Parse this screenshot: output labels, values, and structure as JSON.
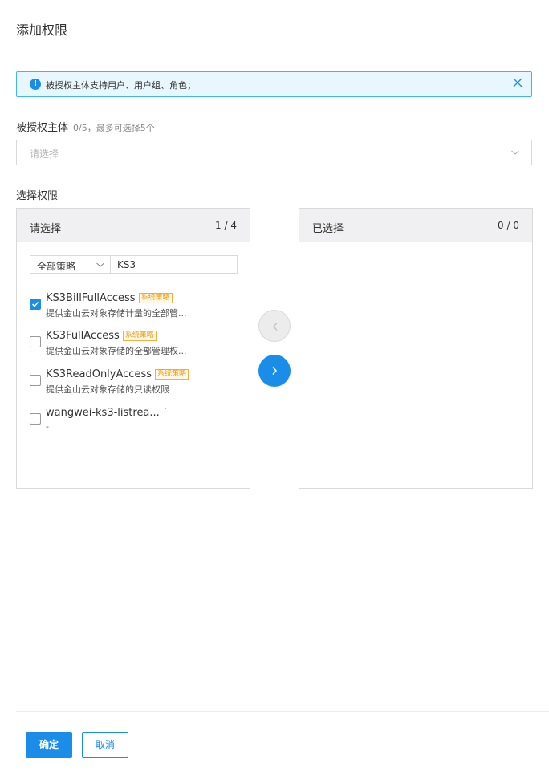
{
  "header": {
    "title": "添加权限"
  },
  "alert": {
    "icon": "info-icon",
    "text": "被授权主体支持用户、用户组、角色；",
    "close_icon": "close-icon"
  },
  "principal": {
    "label": "被授权主体",
    "hint": "0/5，最多可选择5个",
    "placeholder": "请选择"
  },
  "permissions": {
    "label": "选择权限",
    "left_panel": {
      "title": "请选择",
      "count": "1 / 4",
      "filter_select": "全部策略",
      "filter_input": "KS3",
      "items": [
        {
          "name": "KS3BillFullAccess",
          "tag": "系统策略",
          "desc": "提供金山云对象存储计量的全部管...",
          "checked": true
        },
        {
          "name": "KS3FullAccess",
          "tag": "系统策略",
          "desc": "提供金山云对象存储的全部管理权...",
          "checked": false
        },
        {
          "name": "KS3ReadOnlyAccess",
          "tag": "系统策略",
          "desc": "提供金山云对象存储的只读权限",
          "checked": false
        },
        {
          "name": "wangwei-ks3-listrea...",
          "tag": "",
          "desc": "-",
          "checked": false
        }
      ]
    },
    "right_panel": {
      "title": "已选择",
      "count": "0 / 0"
    }
  },
  "footer": {
    "ok_label": "确定",
    "cancel_label": "取消"
  },
  "colors": {
    "primary": "#1a8de9",
    "tag": "#f39c12",
    "alert_bg": "#e8f6fd"
  }
}
